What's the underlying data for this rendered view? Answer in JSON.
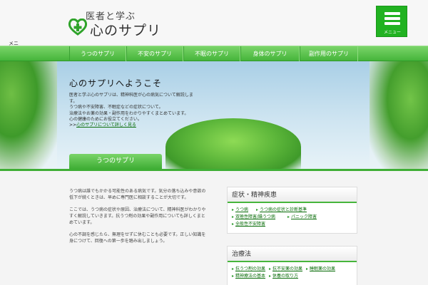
{
  "header": {
    "logo_small": "医者と学ぶ",
    "logo_big": "心のサプリ",
    "menu_label": "メニュー",
    "skip_label": "メニ"
  },
  "nav": {
    "items": [
      {
        "label": "うつのサプリ"
      },
      {
        "label": "不安のサプリ"
      },
      {
        "label": "不眠のサプリ"
      },
      {
        "label": "身体のサプリ"
      },
      {
        "label": "副作用のサプリ"
      }
    ]
  },
  "hero": {
    "title": "心のサプリへようこそ",
    "lines": [
      "医者と学ぶ心のサプリは、精神科医が心の病気について解説します。",
      "うつ病や不安障害、不眠症などの症状について。",
      "治療法やお薬の効果・副作用をわかりやすくまとめています。",
      "心の健康のためにお役立てください。"
    ],
    "link_prefix": ">>",
    "link_text": "心のサプリについて詳しく見る",
    "tab_label": "うつのサプリ"
  },
  "main": {
    "paragraphs": [
      "うつ病は誰でもかかる可能性のある病気です。気分の落ち込みや意欲の低下が続くときは、早めに専門医に相談することが大切です。",
      "ここでは、うつ病の症状や原因、治療法について、精神科医がわかりやすく解説していきます。抗うつ剤の効果や副作用についても詳しくまとめています。",
      "心の不調を感じたら、無理をせずに休むことも必要です。正しい知識を身につけて、回復への第一歩を踏み出しましょう。"
    ]
  },
  "sidebar": {
    "sections": [
      {
        "title": "症状・精神疾患",
        "tags": [
          "うつ病",
          "うつ病の症状と診断基準",
          "双極性障害/躁うつ病",
          "パニック障害",
          "全般性不安障害"
        ]
      },
      {
        "title": "治療法",
        "tags": [
          "抗うつ剤の効果",
          "抗不安薬の効果",
          "睡眠薬の効果",
          "精神療法の基本",
          "休養の取り方"
        ]
      }
    ]
  },
  "colors": {
    "accent_green": "#46b53b",
    "menu_green": "#21b221",
    "link_green": "#0b6e0b"
  }
}
